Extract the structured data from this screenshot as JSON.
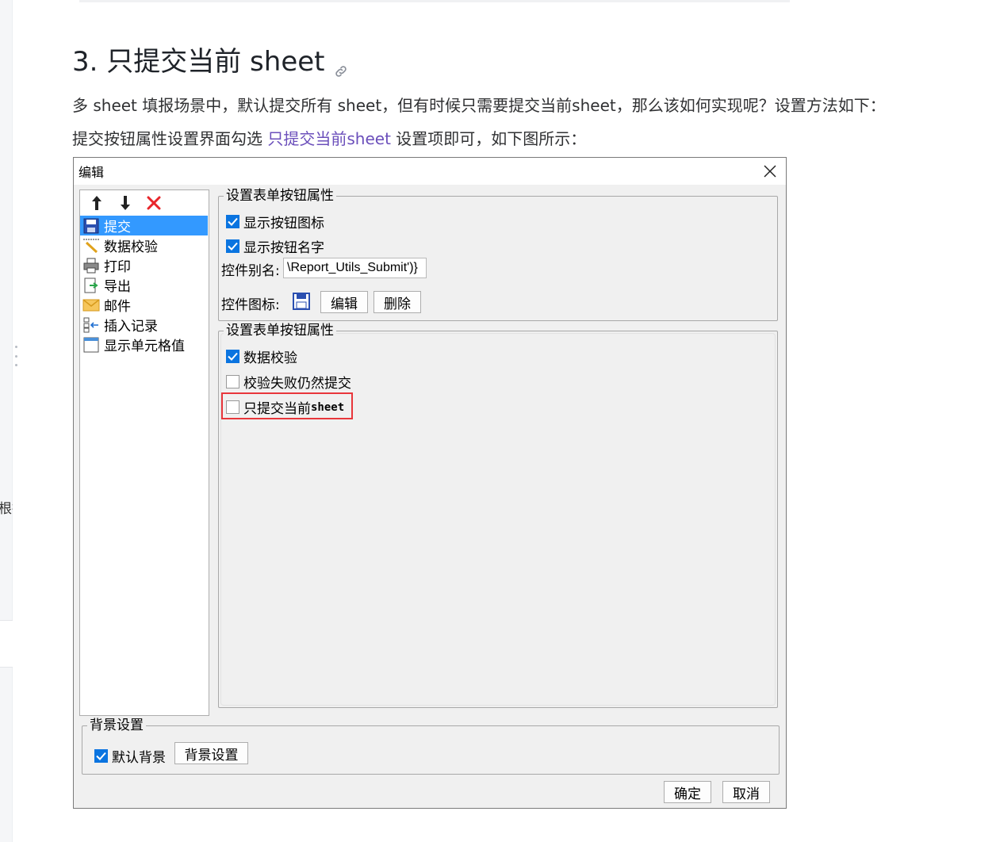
{
  "article": {
    "heading": "3. 只提交当前 sheet",
    "para1": "多 sheet 填报场景中，默认提交所有 sheet，但有时候只需要提交当前sheet，那么该如何实现呢？设置方法如下：",
    "para2_prefix": "提交按钮属性设置界面勾选 ",
    "para2_highlight": "只提交当前sheet",
    "para2_suffix": " 设置项即可，如下图所示：",
    "rail_text": "根据"
  },
  "dialog": {
    "title": "编辑",
    "left_list": [
      {
        "label": "提交",
        "icon": "save-icon",
        "selected": true
      },
      {
        "label": "数据校验",
        "icon": "validate-icon"
      },
      {
        "label": "打印",
        "icon": "printer-icon"
      },
      {
        "label": "导出",
        "icon": "export-icon"
      },
      {
        "label": "邮件",
        "icon": "mail-icon"
      },
      {
        "label": "插入记录",
        "icon": "insert-record-icon"
      },
      {
        "label": "显示单元格值",
        "icon": "cell-value-icon"
      }
    ],
    "group1": {
      "legend": "设置表单按钮属性",
      "show_icon_label": "显示按钮图标",
      "show_icon_checked": true,
      "show_name_label": "显示按钮名字",
      "show_name_checked": true,
      "alias_label": "控件别名:",
      "alias_value": "\\Report_Utils_Submit')}",
      "icon_label": "控件图标:",
      "edit_button": "编辑",
      "delete_button": "删除"
    },
    "group2": {
      "legend": "设置表单按钮属性",
      "validate_label": "数据校验",
      "validate_checked": true,
      "submit_on_fail_label": "校验失败仍然提交",
      "submit_on_fail_checked": false,
      "current_sheet_label_cn": "只提交当前",
      "current_sheet_label_en": "sheet",
      "current_sheet_checked": false
    },
    "background": {
      "legend": "背景设置",
      "default_label": "默认背景",
      "default_checked": true,
      "settings_button": "背景设置"
    },
    "ok_button": "确定",
    "cancel_button": "取消"
  },
  "colors": {
    "highlight_link": "#6b4fbb",
    "selection": "#3399ff",
    "checkbox": "#0a74e0",
    "red_outline": "#e8363b"
  }
}
